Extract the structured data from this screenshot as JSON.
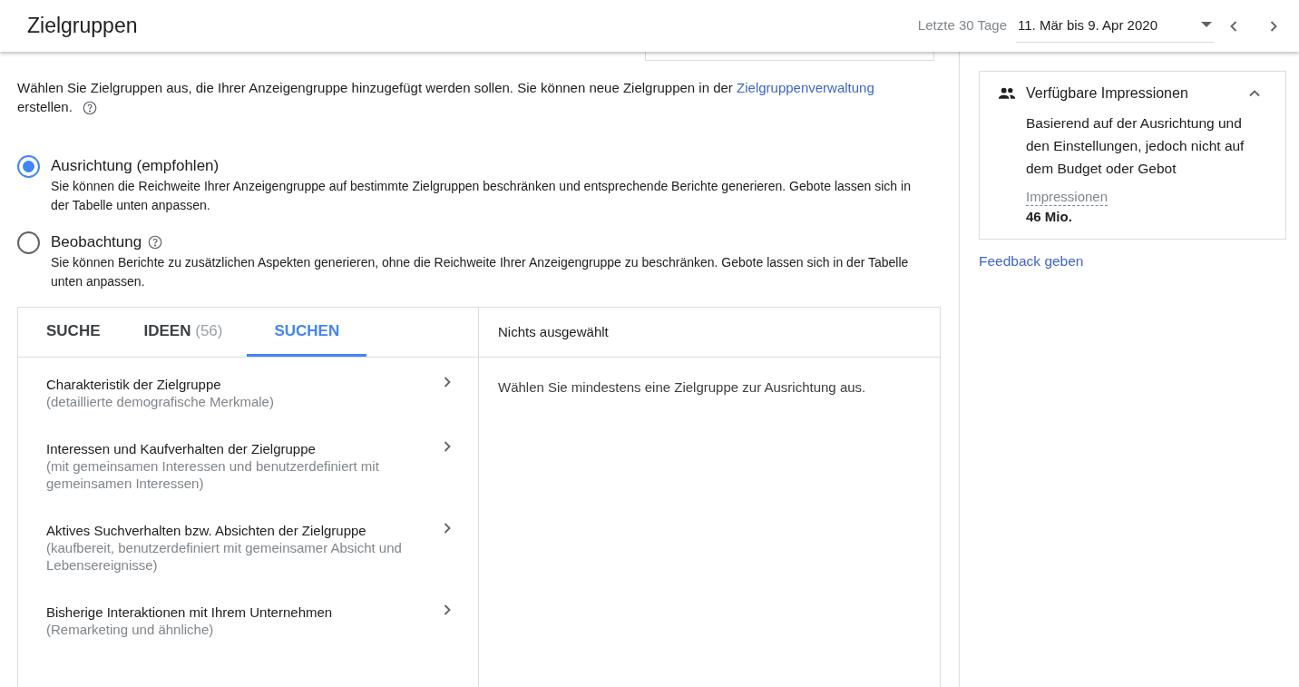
{
  "header": {
    "title": "Zielgruppen",
    "date_range_label": "Letzte 30 Tage",
    "date_range": "11. Mär bis 9. Apr 2020"
  },
  "intro": {
    "text_before": "Wählen Sie Zielgruppen aus, die Ihrer Anzeigengruppe hinzugefügt werden sollen. Sie können neue Zielgruppen in der",
    "link": "Zielgruppenverwaltung",
    "text_after": "erstellen."
  },
  "options": [
    {
      "label": "Ausrichtung (empfohlen)",
      "selected": true,
      "help": false,
      "description": "Sie können die Reichweite Ihrer Anzeigengruppe auf bestimmte Zielgruppen beschränken und entsprechende Berichte generieren. Gebote lassen sich in der Tabelle unten anpassen."
    },
    {
      "label": "Beobachtung",
      "selected": false,
      "help": true,
      "description": "Sie können Berichte zu zusätzlichen Aspekten generieren, ohne die Reichweite Ihrer Anzeigengruppe zu beschränken. Gebote lassen sich in der Tabelle unten anpassen."
    }
  ],
  "tabs": [
    {
      "label": "SUCHE",
      "selected": false
    },
    {
      "label": "IDEEN",
      "count": "(56)",
      "selected": false
    },
    {
      "label": "SUCHEN",
      "selected": true
    }
  ],
  "categories": [
    {
      "title": "Charakteristik der Zielgruppe",
      "subtitle": "(detaillierte demografische Merkmale)"
    },
    {
      "title": "Interessen und Kaufverhalten der Zielgruppe",
      "subtitle": "(mit gemeinsamen Interessen und benutzerdefiniert mit gemeinsamen Interessen)"
    },
    {
      "title": "Aktives Suchverhalten bzw. Absichten der Zielgruppe",
      "subtitle": "(kaufbereit, benutzerdefiniert mit gemeinsamer Absicht und Lebensereignisse)"
    },
    {
      "title": "Bisherige Interaktionen mit Ihrem Unternehmen",
      "subtitle": "(Remarketing und ähnliche)"
    }
  ],
  "selection": {
    "title": "Nichts ausgewählt",
    "message": "Wählen Sie mindestens eine Zielgruppe zur Ausrichtung aus."
  },
  "impressions_card": {
    "title": "Verfügbare Impressionen",
    "expanded": true,
    "description": "Basierend auf der Ausrichtung und den Einstellungen, jedoch nicht auf dem Budget oder Gebot",
    "metric_label": "Impressionen",
    "metric_value": "46 Mio."
  },
  "feedback_link": "Feedback geben"
}
